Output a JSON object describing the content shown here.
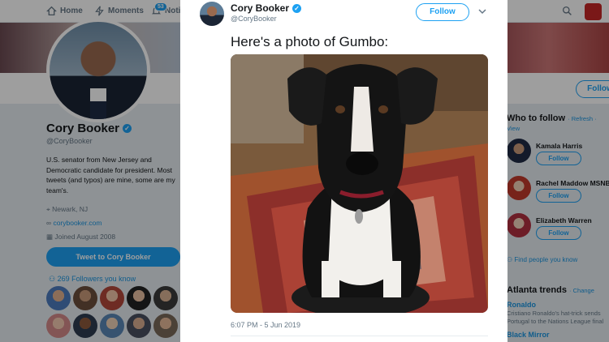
{
  "nav": {
    "home": "Home",
    "moments": "Moments",
    "notifications": "Notif",
    "notif_count": "53"
  },
  "profile": {
    "name": "Cory Booker",
    "handle": "@CoryBooker",
    "bio": "U.S. senator from New Jersey and Democratic candidate for president. Most tweets (and typos) are mine, some are my team's.",
    "location": "Newark, NJ",
    "website": "corybooker.com",
    "joined": "Joined August 2008",
    "tweet_to_label": "Tweet to Cory Booker",
    "followers_you_know": "269 Followers you know",
    "follow_label": "Follow"
  },
  "who_to_follow": {
    "title": "Who to follow",
    "meta": "· Refresh · View",
    "items": [
      {
        "name": "Kamala Harris",
        "follow": "Follow"
      },
      {
        "name": "Rachel Maddow MSNBC",
        "follow": "Follow"
      },
      {
        "name": "Elizabeth Warren",
        "follow": "Follow"
      }
    ],
    "find_people": "Find people you know"
  },
  "trends": {
    "title": "Atlanta trends",
    "meta": "· Change",
    "items": [
      {
        "name": "Ronaldo",
        "desc": "Cristiano Ronaldo's hat-trick sends Portugal to the Nations League final"
      },
      {
        "name": "Black Mirror",
        "desc": ""
      }
    ]
  },
  "tweet": {
    "author_name": "Cory Booker",
    "author_handle": "@CoryBooker",
    "follow_label": "Follow",
    "text": "Here's a photo of Gumbo:",
    "timestamp": "6:07 PM - 5 Jun 2019"
  },
  "colors": {
    "accent": "#1da1f2",
    "link": "#1b95e0",
    "text": "#14171a",
    "muted": "#657786"
  }
}
